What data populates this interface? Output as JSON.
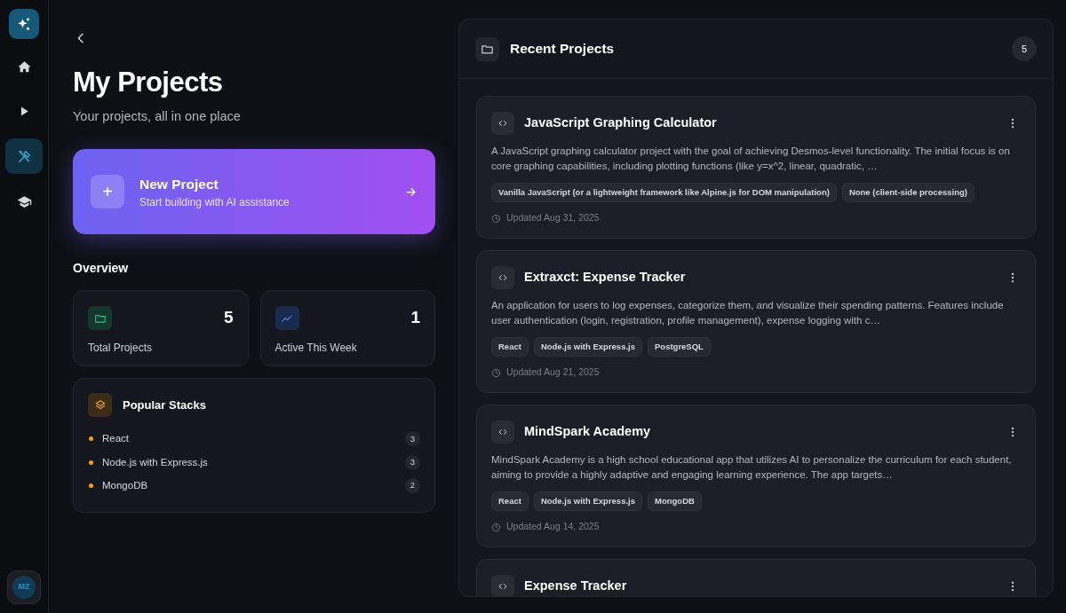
{
  "sidebar": {
    "items": [
      {
        "kind": "home",
        "selected": false
      },
      {
        "kind": "play",
        "selected": false
      },
      {
        "kind": "tools",
        "selected": true
      },
      {
        "kind": "cap",
        "selected": false
      }
    ],
    "avatar": "MZ"
  },
  "header": {
    "title": "My Projects",
    "subtitle": "Your projects, all in one place"
  },
  "new_project": {
    "title": "New Project",
    "subtitle": "Start building with AI assistance",
    "plus": "+"
  },
  "overview": {
    "heading": "Overview",
    "stats": [
      {
        "kind": "folder",
        "value": "5",
        "label": "Total Projects"
      },
      {
        "kind": "trend",
        "value": "1",
        "label": "Active This Week"
      }
    ]
  },
  "popular_stacks": {
    "title": "Popular Stacks",
    "items": [
      {
        "name": "React",
        "count": "3"
      },
      {
        "name": "Node.js with Express.js",
        "count": "3"
      },
      {
        "name": "MongoDB",
        "count": "2"
      }
    ]
  },
  "recent": {
    "title": "Recent Projects",
    "count": "5",
    "projects": [
      {
        "title": "JavaScript Graphing Calculator",
        "description": "A JavaScript graphing calculator project with the goal of achieving Desmos-level functionality. The initial focus is on core graphing capabilities, including plotting functions (like y=x^2, linear, quadratic, …",
        "tags": [
          "Vanilla JavaScript (or a lightweight framework like Alpine.js for DOM manipulation)",
          "None (client-side processing)"
        ],
        "updated": "Updated Aug 31, 2025"
      },
      {
        "title": "Extraxct: Expense Tracker",
        "description": "An application for users to log expenses, categorize them, and visualize their spending patterns. Features include user authentication (login, registration, profile management), expense logging with c…",
        "tags": [
          "React",
          "Node.js with Express.js",
          "PostgreSQL"
        ],
        "updated": "Updated Aug 21, 2025"
      },
      {
        "title": "MindSpark Academy",
        "description": "MindSpark Academy is a high school educational app that utilizes AI to personalize the curriculum for each student, aiming to provide a highly adaptive and engaging learning experience. The app targets…",
        "tags": [
          "React",
          "Node.js with Express.js",
          "MongoDB"
        ],
        "updated": "Updated Aug 14, 2025"
      },
      {
        "title": "Expense Tracker"
      }
    ]
  }
}
